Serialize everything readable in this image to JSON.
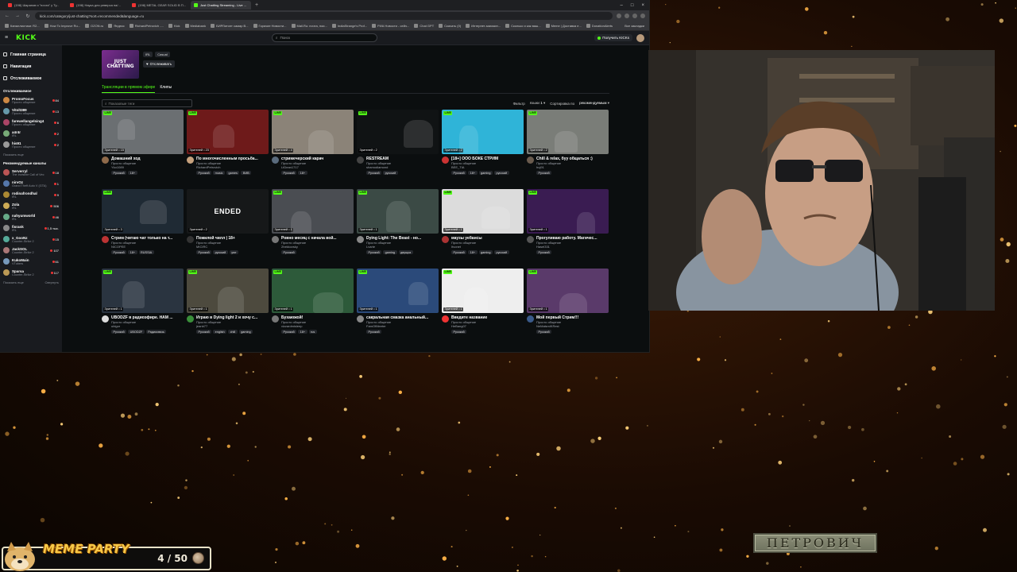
{
  "browser": {
    "tabs": [
      {
        "label": "(198) Шарапов и \"почта\" у Ту...",
        "active": false
      },
      {
        "label": "(198) Наука для реверса на/...",
        "active": false
      },
      {
        "label": "(198) METAL GEAR SOLID В П...",
        "active": false
      },
      {
        "label": "Just Chatting Streaming - Live ...",
        "active": true
      }
    ],
    "url": "kick.com/category/just-chatting?sort=recommended&language=ru",
    "bookmarks": [
      "Каналлистики: R2...",
      "How To Improve Ru...",
      "OZON.ru",
      "Яндекс",
      "RichardPetrovich -...",
      "Kick",
      "Mediabank",
      "БИРЛитопт самар В...",
      "Горячие Новости...",
      "Mail.Ru: почта, пои...",
      "IndiaStrange's Prof...",
      "РИА Новости - сейч...",
      "Chat GPT",
      "Скачать (0)",
      "Интернет-магазин...",
      "Сколько и как ваш...",
      "Meme | Доставка е...",
      "DonationAlerts"
    ],
    "all_bookmarks": "Все закладки"
  },
  "kick": {
    "logo": "KICK",
    "search_placeholder": "Поиск",
    "get_kicks": "Получить KICKs",
    "nav": [
      "Главная страница",
      "Навигация",
      "Отслеживаемое"
    ],
    "following_header": "Отслеживаемое",
    "following": [
      {
        "name": "PromoFocus",
        "sub": "Просто общение",
        "viewers": "84"
      },
      {
        "name": "Vitolt389",
        "sub": "Просто общение",
        "viewers": "13"
      },
      {
        "name": "farewellangelsing4",
        "sub": "Просто общение",
        "viewers": "6"
      },
      {
        "name": "a4r4r",
        "sub": "IRL",
        "viewers": "2"
      },
      {
        "name": "his91",
        "sub": "Просто общение",
        "viewers": "2"
      }
    ],
    "show_more": "Показать еще",
    "recommended_header": "Рекомендуемые каналы",
    "recommended": [
      {
        "name": "Serverryl",
        "sub": "The Invisible Call of Vec",
        "viewers": "18"
      },
      {
        "name": "nirvOz",
        "sub": "Grand Theft Auto V (GTA)",
        "viewers": "1"
      },
      {
        "name": "rodinafrondhal",
        "sub": "IRL",
        "viewers": "9"
      },
      {
        "name": "Zola",
        "sub": "IRL",
        "viewers": "506"
      },
      {
        "name": "nahyumworld",
        "sub": "IRL",
        "viewers": "46"
      },
      {
        "name": "fisrank",
        "sub": "IRL",
        "viewers": "1,5 тыс."
      },
      {
        "name": "x_GooNz",
        "sub": "Counter-Strike 2",
        "viewers": "15"
      },
      {
        "name": "JackSOL",
        "sub": "Counter-Strike 2",
        "viewers": "107"
      },
      {
        "name": "KukoMain",
        "sub": "VTubers",
        "viewers": "61"
      },
      {
        "name": "Sparsa",
        "sub": "Counter-Strike 2",
        "viewers": "117"
      }
    ],
    "show_more_2": "Показать еще",
    "collapse": "Свернуть",
    "category": {
      "thumb_text_1": "JUST",
      "thumb_text_2": "CHATTING",
      "tags": [
        "IRL",
        "Casual"
      ],
      "follow": "Отслеживать"
    },
    "tabs": [
      "Трансляции в прямом эфире",
      "Клипы"
    ],
    "tag_search_placeholder": "Показовые теги",
    "filter_label": "Фильтр",
    "languages_label": "языки",
    "languages_count": "1",
    "sort_label": "Сортировка по",
    "sort_value": "рекомендуемым",
    "live_badge": "LIVE",
    "cards": [
      {
        "viewers": "Зрителей • 15",
        "title": "Домашний ход",
        "category": "Просто общение",
        "channel": "Yko1089",
        "tags": [
          "Русский",
          "18+"
        ],
        "thumb": "#6b6f72",
        "av": "#8f6a4a",
        "ended": ""
      },
      {
        "viewers": "Зрителей • 23",
        "title": "По многочисленным просьба...",
        "category": "Просто общение",
        "channel": "RichardPetrovich",
        "tags": [
          "Русский",
          "music",
          "games",
          "ВИВ"
        ],
        "thumb": "#6e1a1a",
        "av": "#c7a27e",
        "ended": ""
      },
      {
        "viewers": "Зрителей • 4",
        "title": "стримечерский карач",
        "category": "Просто общение",
        "channel": "LtDean1717",
        "tags": [
          "Русский",
          "18+"
        ],
        "thumb": "#8b8378",
        "av": "#5a6b7d",
        "ended": ""
      },
      {
        "viewers": "Зрителей • 2",
        "title": "RESTREAM",
        "category": "Просто общение",
        "channel": "shamodiamond",
        "tags": [
          "Русский",
          "русский"
        ],
        "thumb": "#101314",
        "av": "#444",
        "ended": ""
      },
      {
        "viewers": "Зрителей • 2",
        "title": "[18+] ООО БОКЕ СТРИМ",
        "category": "Просто общение",
        "channel": "BEE_TIA",
        "tags": [
          "Русский",
          "18+",
          "gaming",
          "русский"
        ],
        "thumb": "#2fb4d8",
        "av": "#c33",
        "ended": ""
      },
      {
        "viewers": "Зрителей • 2",
        "title": "Chill & relax, буу общаться :)",
        "category": "Просто общение",
        "channel": "huj91",
        "tags": [
          "Русский"
        ],
        "thumb": "#7a7d78",
        "av": "#6a5b4e",
        "ended": ""
      },
      {
        "viewers": "Зрителей • 3",
        "title": "Стрим (читаю чат только на т...",
        "category": "Просто общение",
        "channel": "NICOPEE",
        "tags": [
          "Русский",
          "18+",
          "RUSSIA"
        ],
        "thumb": "#1f2a34",
        "av": "#b33",
        "ended": ""
      },
      {
        "viewers": "Зрителей • 2",
        "title": "Пожилой чилл | 18+",
        "category": "Просто общение",
        "channel": "MICIRC",
        "tags": [
          "Русский",
          "русский",
          "уют"
        ],
        "thumb": "#161819",
        "av": "#333",
        "ended": "ENDED"
      },
      {
        "viewers": "Зрителей • 1",
        "title": "Ровно месяц с начала вой...",
        "category": "Просто общение",
        "channel": "2hekkovsky",
        "tags": [
          "Русский"
        ],
        "thumb": "#4a4d52",
        "av": "#777",
        "ended": ""
      },
      {
        "viewers": "Зрителей • 1",
        "title": "Dying Light: The Beast - но...",
        "category": "Просто общение",
        "channel": "Lvarte",
        "tags": [
          "Русский",
          "gaming",
          "двущка"
        ],
        "thumb": "#3b4a45",
        "av": "#888",
        "ended": ""
      },
      {
        "viewers": "Зрителей • 1",
        "title": "маузы уебансы",
        "category": "Просто общение",
        "channel": "Itvonet",
        "tags": [
          "Русский",
          "18+",
          "gaming",
          "русский"
        ],
        "thumb": "#dcdcdc",
        "av": "#a33",
        "ended": ""
      },
      {
        "viewers": "Зрителей • 1",
        "title": "Прогуливаю работу. Магичес...",
        "category": "Просто общение",
        "channel": "Hasel331",
        "tags": [
          "Русский"
        ],
        "thumb": "#3a1c52",
        "av": "#555",
        "ended": ""
      },
      {
        "viewers": "Зрителей • 1",
        "title": "UBODZF в радиоэфире. НАМ ...",
        "category": "Просто общение",
        "channel": "ubigor",
        "tags": [
          "Русский",
          "UBODZF",
          "Радиосвязь"
        ],
        "thumb": "#2a3440",
        "av": "#ddd",
        "ended": ""
      },
      {
        "viewers": "Зрителей • 1",
        "title": "Играю в Dying light 2 и хочу с...",
        "category": "Просто общение",
        "channel": "jeanb77",
        "tags": [
          "Русский",
          "english",
          "chill",
          "gaming"
        ],
        "thumb": "#4d4a3e",
        "av": "#3a8f3a",
        "ended": ""
      },
      {
        "viewers": "Зрителей • 1",
        "title": "Бухаюжой!",
        "category": "Просто общение",
        "channel": "vizzardmisleep",
        "tags": [
          "Русский",
          "18+",
          "rus"
        ],
        "thumb": "#2d5a3a",
        "av": "#777",
        "ended": ""
      },
      {
        "viewers": "Зрителей • 1",
        "title": "сакральная смазка анальный...",
        "category": "Просто общение",
        "channel": "FamOfMeeter",
        "tags": [
          "Русский"
        ],
        "thumb": "#2b4a7a",
        "av": "#888",
        "ended": ""
      },
      {
        "viewers": "Зрителей • 1",
        "title": "Введите название",
        "category": "Просто общение",
        "channel": "HeBang07",
        "tags": [
          "Русский"
        ],
        "thumb": "#eeeeee",
        "av": "#e33",
        "ended": ""
      },
      {
        "viewers": "Зрителей • 1",
        "title": "Мой первый Стрим!!!",
        "category": "Просто общение",
        "channel": "NeMalsmiKRest",
        "tags": [
          "Русский"
        ],
        "thumb": "#5a3a6a",
        "av": "#3a5a8a",
        "ended": ""
      }
    ]
  },
  "overlay": {
    "meme_title": "MEME PARTY",
    "meme_count": "4 / 50",
    "plate_text": "ПЕТРОВИЧ"
  },
  "colors": {
    "kick_green": "#53fc18",
    "page_bg": "#0b0e0f",
    "sidebar_bg": "#191b1f",
    "meme_gold": "#f7c948",
    "plate_bg": "#8c8f78"
  }
}
